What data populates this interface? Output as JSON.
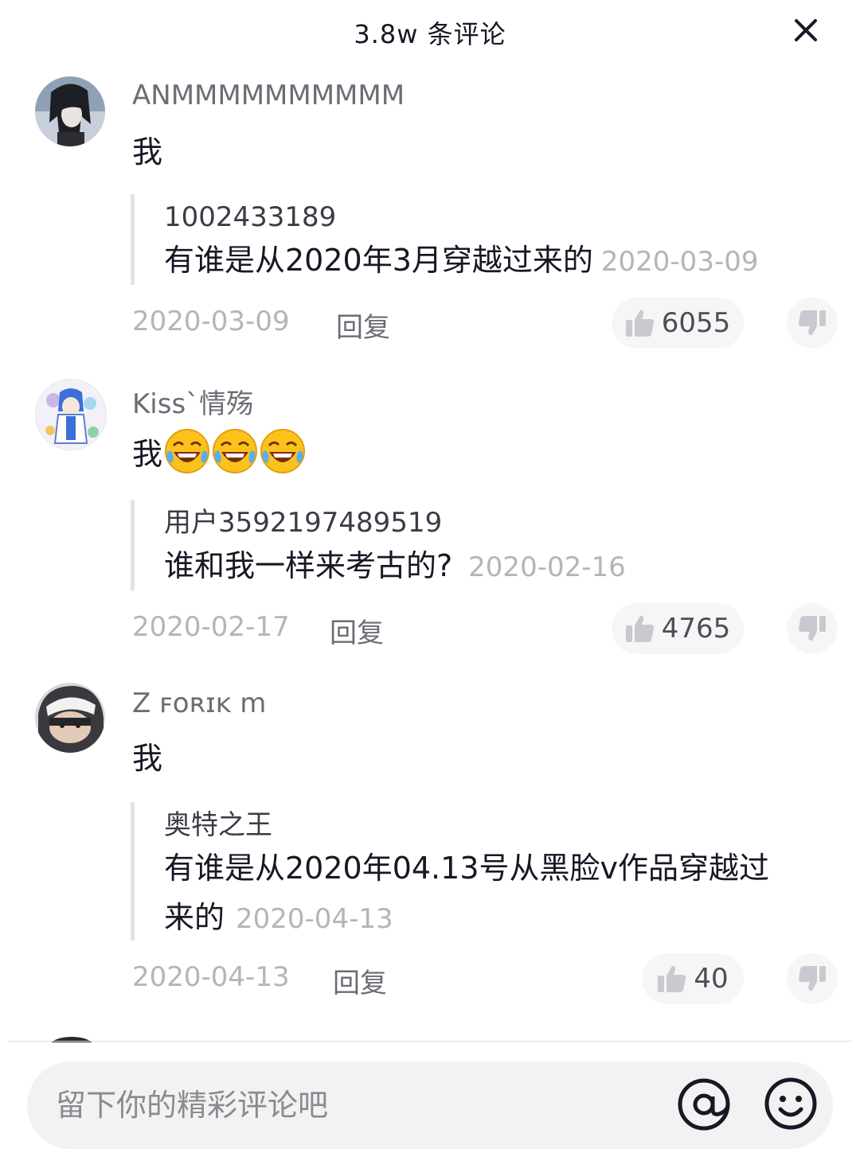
{
  "header": {
    "title": "3.8w 条评论",
    "close_icon": "close-icon"
  },
  "comments": [
    {
      "username": "ANMMMMMMMMMM",
      "text": "我",
      "quote": {
        "username": "1002433189",
        "text": "有谁是从2020年3月穿越过来的",
        "date": "2020-03-09"
      },
      "date": "2020-03-09",
      "reply_label": "回复",
      "likes": "6055"
    },
    {
      "username": "Kiss`情殇",
      "text": "我",
      "emojis": [
        "laughing-crying-emoji",
        "laughing-crying-emoji",
        "laughing-crying-emoji"
      ],
      "quote": {
        "username": "用户3592197489519",
        "text": "谁和我一样来考古的?",
        "date": "2020-02-16"
      },
      "date": "2020-02-17",
      "reply_label": "回复",
      "likes": "4765"
    },
    {
      "username": "Z ꜰᴏʀɪᴋ m",
      "text": "我",
      "quote": {
        "username": "奥特之王",
        "text_line1": "有谁是从2020年04.13号从黑脸v作品穿越过",
        "text_line2": "来的",
        "date": "2020-04-13"
      },
      "date": "2020-04-13",
      "reply_label": "回复",
      "likes": "40"
    }
  ],
  "composer": {
    "placeholder": "留下你的精彩评论吧",
    "at_icon": "at-icon",
    "emoji_icon": "smiley-icon"
  },
  "colors": {
    "text": "#161823",
    "secondary": "#6b6d75",
    "muted": "#b4b5ba",
    "pill": "#f6f6f7"
  }
}
